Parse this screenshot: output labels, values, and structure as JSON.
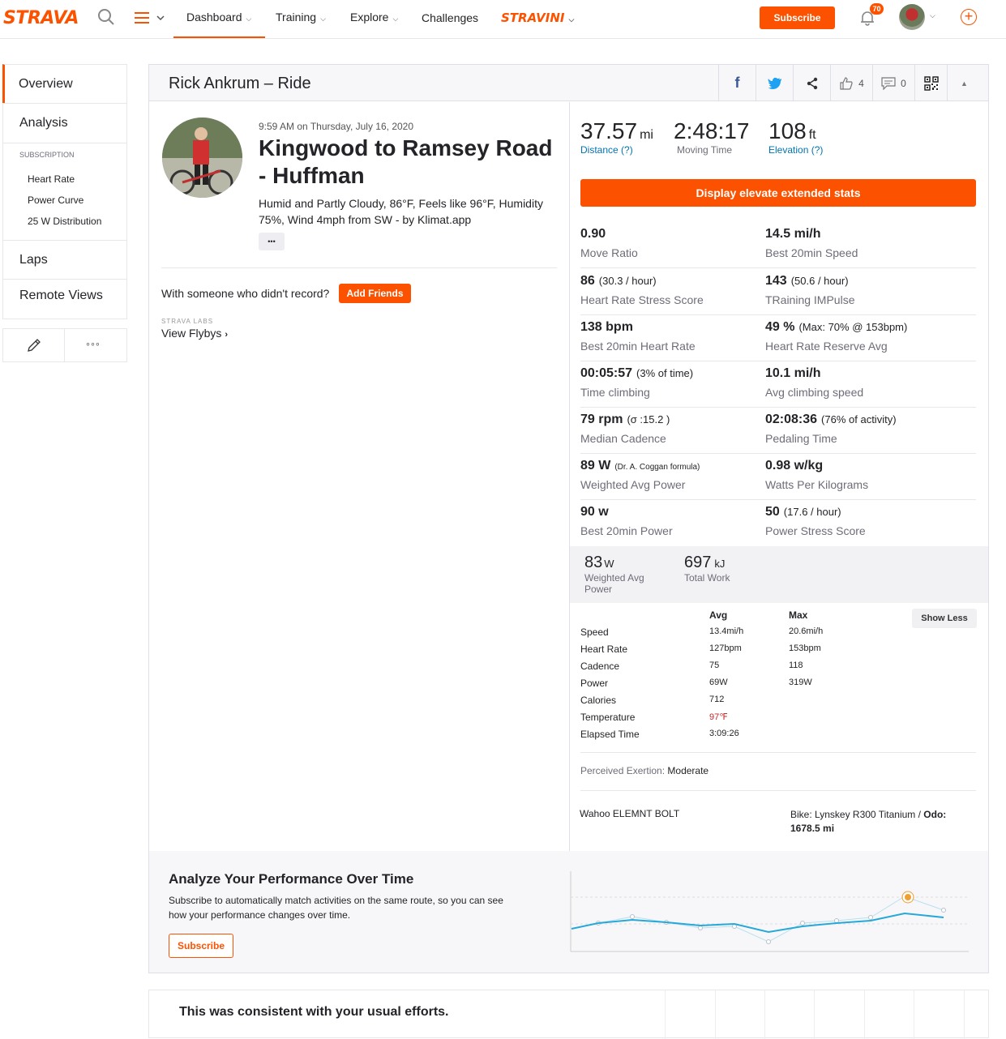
{
  "nav": {
    "logo": "STRAVA",
    "dashboard": "Dashboard",
    "training": "Training",
    "explore": "Explore",
    "challenges": "Challenges",
    "stravini": "STRAVINI",
    "subscribe": "Subscribe",
    "notification_count": "70"
  },
  "sidebar": {
    "overview": "Overview",
    "analysis": "Analysis",
    "subscription_heading": "SUBSCRIPTION",
    "heart_rate": "Heart Rate",
    "power_curve": "Power Curve",
    "distribution": "25 W Distribution",
    "laps": "Laps",
    "remote_views": "Remote Views"
  },
  "header": {
    "title": "Rick Ankrum – Ride",
    "kudos_count": "4",
    "comment_count": "0"
  },
  "activity": {
    "datetime": "9:59 AM on Thursday, July 16, 2020",
    "name_line1": "Kingwood to Ramsey Road",
    "name_line2": "- Huffman",
    "weather_line1": "Humid and Partly Cloudy, 86°F, Feels like 96°F, Humidity",
    "weather_line2": "75%, Wind 4mph from SW - by Klimat.app",
    "more": "•••",
    "with_someone": "With someone who didn't record?",
    "add_friends": "Add Friends",
    "labs": "STRAVA LABS",
    "flybys": "View Flybys"
  },
  "summary": {
    "distance_value": "37.57",
    "distance_unit": "mi",
    "distance_label": "Distance (?)",
    "time_value": "2:48:17",
    "time_label": "Moving Time",
    "elev_value": "108",
    "elev_unit": "ft",
    "elev_label": "Elevation (?)",
    "elevate_button": "Display elevate extended stats"
  },
  "ext_stats": [
    {
      "l_val": "0.90",
      "l_extra": "",
      "l_label": "Move Ratio",
      "r_val": "14.5 mi/h",
      "r_extra": "",
      "r_label": "Best 20min Speed"
    },
    {
      "l_val": "86",
      "l_extra": "(30.3 / hour)",
      "l_label": "Heart Rate Stress Score",
      "r_val": "143",
      "r_extra": "(50.6 / hour)",
      "r_label": "TRaining IMPulse"
    },
    {
      "l_val": "138 bpm",
      "l_extra": "",
      "l_label": "Best 20min Heart Rate",
      "r_val": "49 %",
      "r_extra": "(Max: 70% @ 153bpm)",
      "r_label": "Heart Rate Reserve Avg"
    },
    {
      "l_val": "00:05:57",
      "l_extra": "(3% of time)",
      "l_label": "Time climbing",
      "r_val": "10.1 mi/h",
      "r_extra": "",
      "r_label": "Avg climbing speed"
    },
    {
      "l_val": "79 rpm",
      "l_extra": "(σ :15.2 )",
      "l_label": "Median Cadence",
      "r_val": "02:08:36",
      "r_extra": "(76% of activity)",
      "r_label": "Pedaling Time"
    },
    {
      "l_val": "89 W",
      "l_extra": "(Dr. A. Coggan formula)",
      "l_label": "Weighted Avg Power",
      "r_val": "0.98 w/kg",
      "r_extra": "",
      "r_label": "Watts Per Kilograms"
    },
    {
      "l_val": "90 w",
      "l_extra": "",
      "l_label": "Best 20min Power",
      "r_val": "50",
      "r_extra": "(17.6 / hour)",
      "r_label": "Power Stress Score"
    }
  ],
  "power": {
    "wap_value": "83",
    "wap_unit": "W",
    "wap_label1": "Weighted Avg",
    "wap_label2": "Power",
    "work_value": "697",
    "work_unit": "kJ",
    "work_label": "Total Work"
  },
  "table": {
    "avg_header": "Avg",
    "max_header": "Max",
    "show_less": "Show Less",
    "rows": [
      {
        "label": "Speed",
        "avg": "13.4mi/h",
        "max": "20.6mi/h"
      },
      {
        "label": "Heart Rate",
        "avg": "127bpm",
        "max": "153bpm"
      },
      {
        "label": "Cadence",
        "avg": "75",
        "max": "118"
      },
      {
        "label": "Power",
        "avg": "69W",
        "max": "319W"
      },
      {
        "label": "Calories",
        "avg": "712",
        "max": ""
      },
      {
        "label": "Temperature",
        "avg": "97℉",
        "max": ""
      },
      {
        "label": "Elapsed Time",
        "avg": "3:09:26",
        "max": ""
      }
    ]
  },
  "exertion": {
    "label": "Perceived Exertion:",
    "value": "Moderate"
  },
  "device": {
    "name": "Wahoo ELEMNT BOLT",
    "bike_prefix": "Bike: Lynskey R300 Titanium / ",
    "odo_label": "Odo:",
    "odo_value": "1678.5 mi"
  },
  "promo": {
    "title": "Analyze Your Performance Over Time",
    "line1": "Subscribe to automatically match activities on the same route, so you can see",
    "line2": "how your performance changes over time.",
    "button": "Subscribe"
  },
  "bottom": {
    "text": "This was consistent with your usual efforts."
  },
  "colors": {
    "accent": "#fc5200",
    "link": "#0073b0",
    "temp": "#c62828",
    "chart": "#26a8d8"
  }
}
